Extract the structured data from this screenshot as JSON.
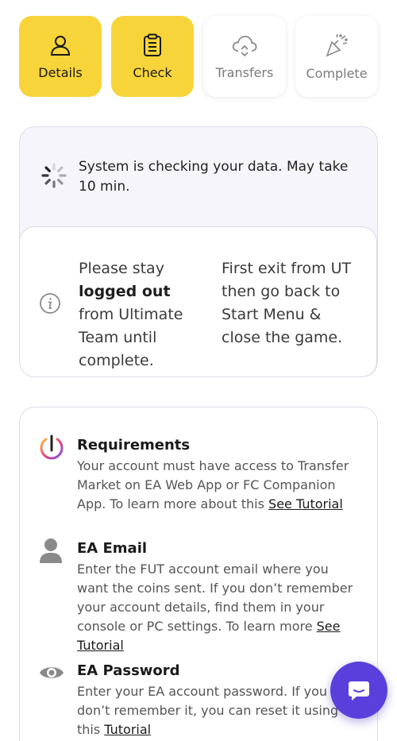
{
  "steps": [
    {
      "label": "Details",
      "icon": "user-icon",
      "active": true
    },
    {
      "label": "Check",
      "icon": "clipboard-icon",
      "active": true
    },
    {
      "label": "Transfers",
      "icon": "cloud-sync-icon",
      "active": false
    },
    {
      "label": "Complete",
      "icon": "party-popper-icon",
      "active": false
    }
  ],
  "status": {
    "message": "System is checking your data. May take 10 min."
  },
  "notice": {
    "left_pre": "Please stay ",
    "left_bold": "logged out",
    "left_post": " from Ultimate Team until complete.",
    "right": "First exit from UT then go back to Start Menu & close the game."
  },
  "requirements": [
    {
      "title": "Requirements",
      "desc": "Your account must have access to Transfer Market on EA Web App or FC Companion App. To learn more about this ",
      "link": "See Tutorial",
      "icon": "info-ring-icon"
    },
    {
      "title": "EA Email",
      "desc": "Enter the FUT account email where you want the coins sent. If you don’t remember your account details, find them in your console or PC settings. To learn more ",
      "link": "See Tutorial",
      "icon": "person-icon"
    },
    {
      "title": "EA Password",
      "desc": "Enter your EA account password. If you don’t remember it, you can reset it using this ",
      "link": "Tutorial",
      "icon": "eye-icon"
    }
  ],
  "colors": {
    "accent_yellow": "#f7d43a",
    "chat_purple": "#5b3fdc"
  }
}
